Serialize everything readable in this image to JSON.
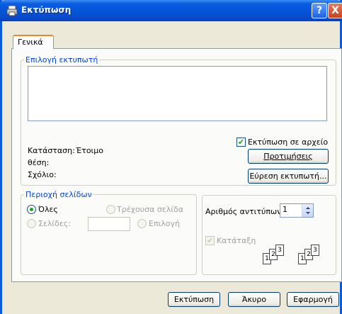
{
  "window": {
    "title": "Εκτύπωση"
  },
  "tabs": [
    {
      "label": "Γενικά"
    }
  ],
  "printer_group": {
    "legend": "Επιλογή εκτυπωτή",
    "status_label": "Κατάσταση:",
    "status_value": "Έτοιμο",
    "location_label": "θέση:",
    "comment_label": "Σχόλιο:",
    "print_to_file_label": "Εκτύπωση σε αρχείο",
    "print_to_file_checked": true,
    "preferences_label": "Προτιμήσεις",
    "find_printer_label": "Εύρεση εκτυπωτή..."
  },
  "page_range": {
    "legend": "Περιοχή σελίδων",
    "all_label": "Όλες",
    "current_page_label": "Τρέχουσα σελίδα",
    "pages_label": "Σελίδες:",
    "pages_value": "",
    "selection_label": "Επιλογή"
  },
  "copies": {
    "label": "Αριθμός αντιτύπων",
    "value": "1",
    "collate_label": "Κατάταξη",
    "collate_checked": true
  },
  "buttons": {
    "print_label": "Εκτύπωση",
    "cancel_label": "Άκυρο",
    "apply_label": "Εφαρμογή"
  },
  "icons": {
    "help": "?",
    "close": "X"
  },
  "colors": {
    "titlebar": "#0454d8",
    "legend": "#0046d5",
    "tab_accent": "#e68b2c"
  }
}
